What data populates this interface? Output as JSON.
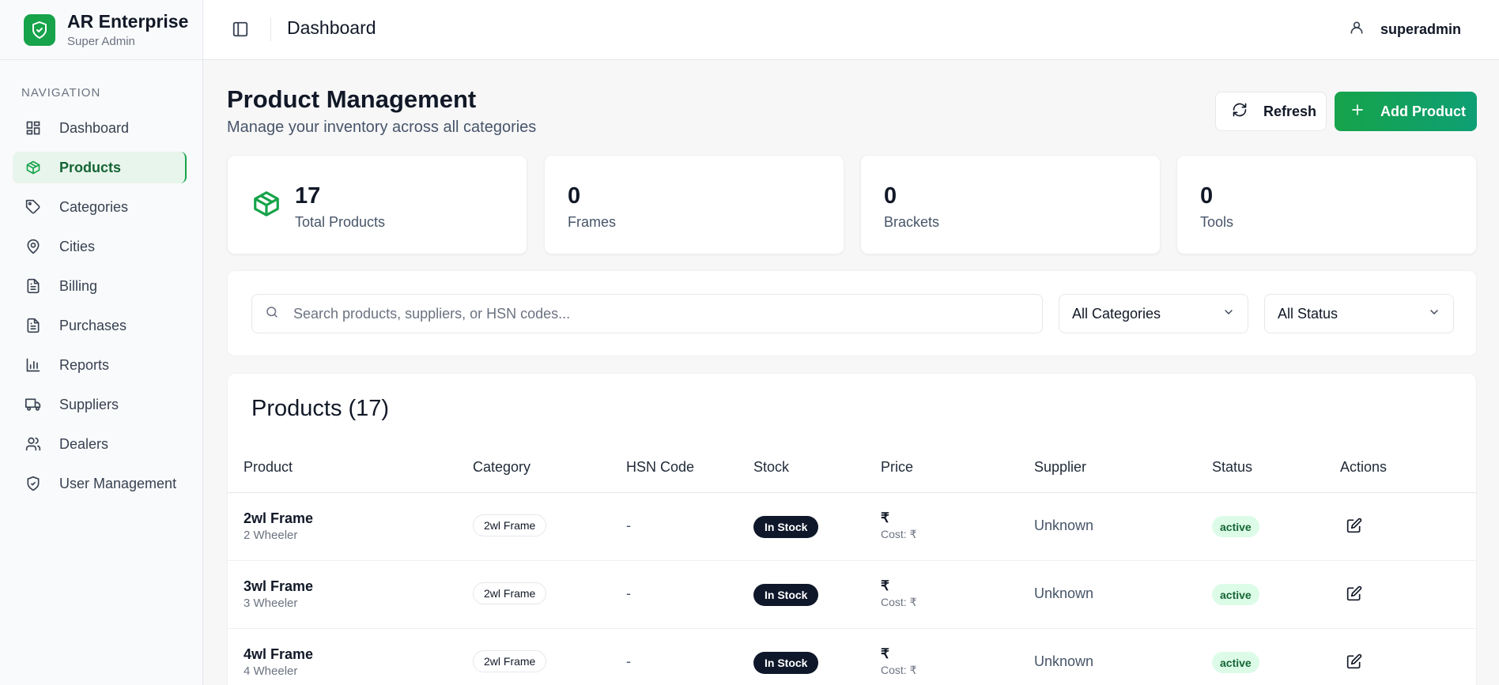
{
  "brand": {
    "name": "AR Enterprise",
    "role": "Super Admin"
  },
  "nav": {
    "heading": "NAVIGATION",
    "items": [
      {
        "label": "Dashboard",
        "icon": "grid-icon"
      },
      {
        "label": "Products",
        "icon": "package-icon",
        "active": true
      },
      {
        "label": "Categories",
        "icon": "tag-icon"
      },
      {
        "label": "Cities",
        "icon": "map-pin-icon"
      },
      {
        "label": "Billing",
        "icon": "file-text-icon"
      },
      {
        "label": "Purchases",
        "icon": "file-text-icon"
      },
      {
        "label": "Reports",
        "icon": "bar-chart-icon"
      },
      {
        "label": "Suppliers",
        "icon": "truck-icon"
      },
      {
        "label": "Dealers",
        "icon": "users-icon"
      },
      {
        "label": "User Management",
        "icon": "shield-check-icon"
      }
    ]
  },
  "topbar": {
    "title": "Dashboard",
    "user": "superadmin"
  },
  "page": {
    "title": "Product Management",
    "subtitle": "Manage your inventory across all categories",
    "refresh_label": "Refresh",
    "add_label": "Add Product"
  },
  "stats": [
    {
      "value": "17",
      "label": "Total Products"
    },
    {
      "value": "0",
      "label": "Frames"
    },
    {
      "value": "0",
      "label": "Brackets"
    },
    {
      "value": "0",
      "label": "Tools"
    }
  ],
  "filters": {
    "search_placeholder": "Search products, suppliers, or HSN codes...",
    "category": "All Categories",
    "status": "All Status"
  },
  "table": {
    "title": "Products (17)",
    "columns": [
      "Product",
      "Category",
      "HSN Code",
      "Stock",
      "Price",
      "Supplier",
      "Status",
      "Actions"
    ],
    "rows": [
      {
        "name": "2wl Frame",
        "sub": "2 Wheeler",
        "category": "2wl Frame",
        "hsn": "-",
        "stock": "In Stock",
        "price": "₹",
        "cost": "Cost: ₹",
        "supplier": "Unknown",
        "status": "active"
      },
      {
        "name": "3wl Frame",
        "sub": "3 Wheeler",
        "category": "2wl Frame",
        "hsn": "-",
        "stock": "In Stock",
        "price": "₹",
        "cost": "Cost: ₹",
        "supplier": "Unknown",
        "status": "active"
      },
      {
        "name": "4wl Frame",
        "sub": "4 Wheeler",
        "category": "2wl Frame",
        "hsn": "-",
        "stock": "In Stock",
        "price": "₹",
        "cost": "Cost: ₹",
        "supplier": "Unknown",
        "status": "active"
      }
    ]
  },
  "colors": {
    "accent": "#16a34a",
    "dark": "#0f172a",
    "status_bg": "#dcfce7"
  }
}
